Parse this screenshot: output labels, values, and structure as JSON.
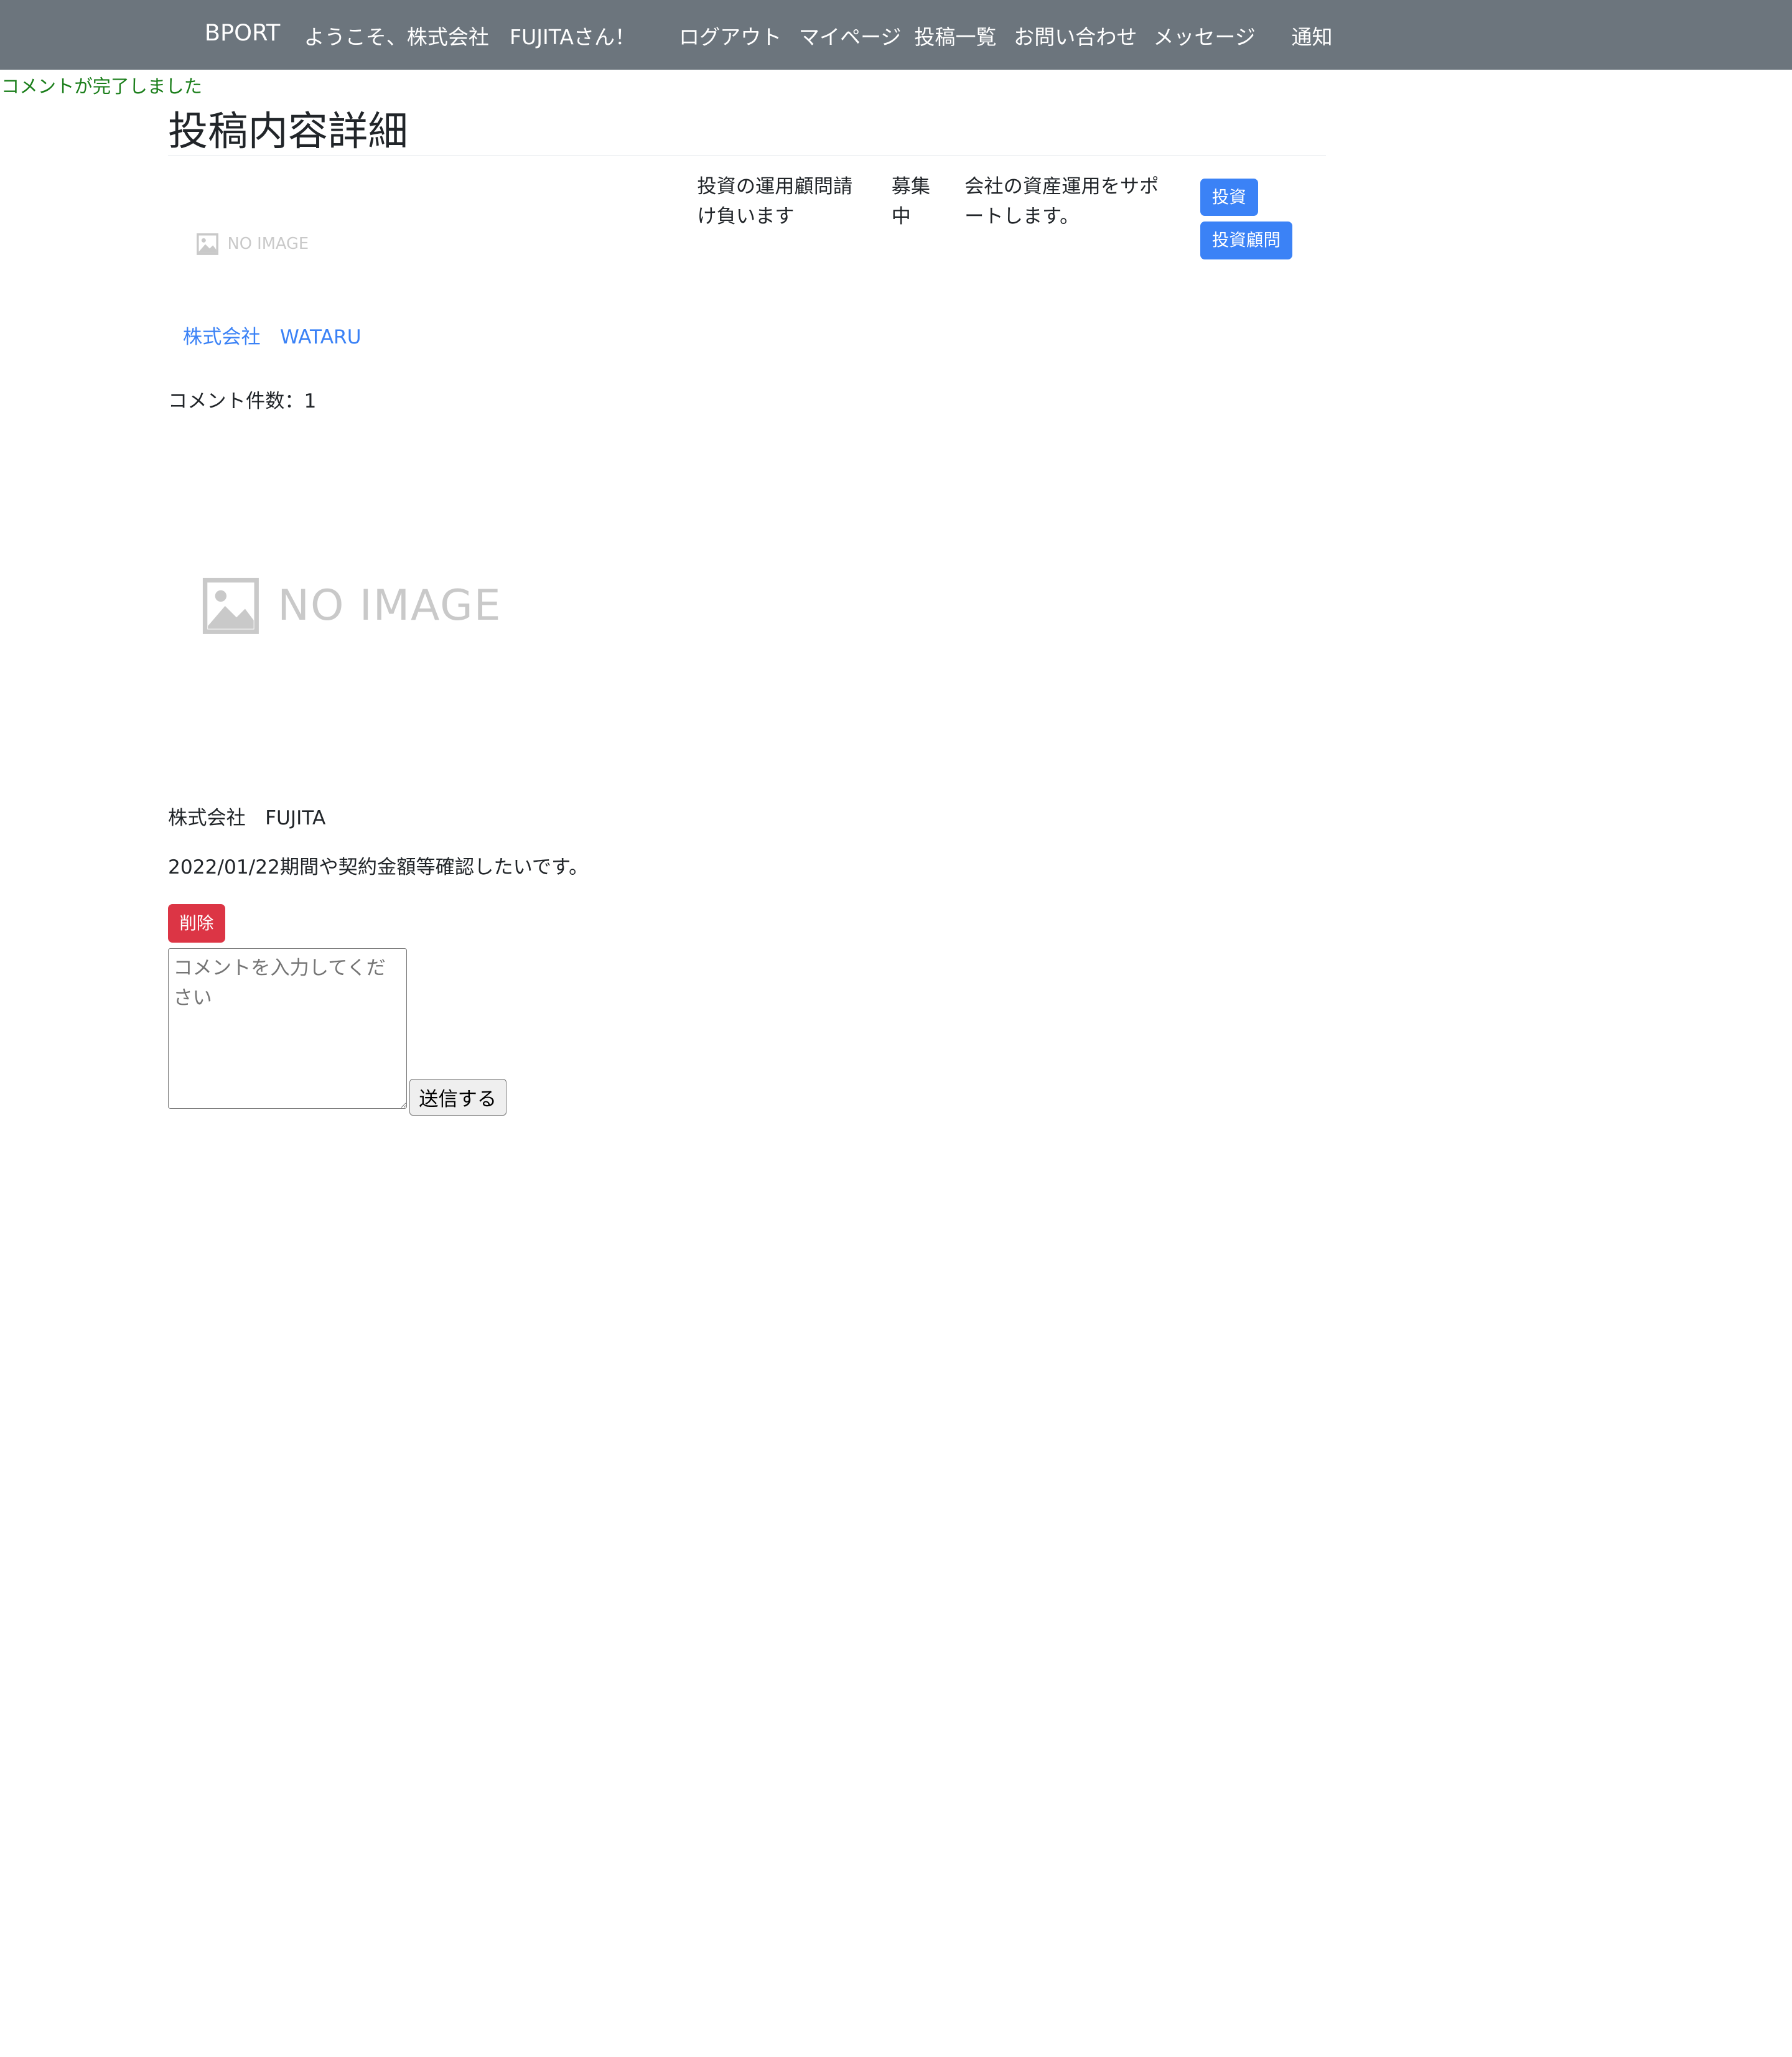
{
  "navbar": {
    "brand": "BPORT",
    "welcome": "ようこそ、株式会社　FUJITAさん！",
    "links": {
      "logout": "ログアウト",
      "mypage": "マイページ",
      "posts": "投稿一覧",
      "contact": "お問い合わせ",
      "messages": "メッセージ",
      "notifications": "通知"
    }
  },
  "flash": {
    "text": "コメントが完了しました",
    "color": "#1a7e1a"
  },
  "page": {
    "title": "投稿内容詳細"
  },
  "post": {
    "image_placeholder": "NO IMAGE",
    "title": "投資の運用顧問請け負います",
    "status": "募集中",
    "description": "会社の資産運用をサポートします。",
    "tags": [
      "投資",
      "投資顧問"
    ],
    "company": "株式会社　WATARU"
  },
  "comments": {
    "count_label": "コメント件数：1",
    "items": [
      {
        "image_placeholder": "NO IMAGE",
        "author": "株式会社　FUJITA",
        "body": "2022/01/22期間や契約金額等確認したいです。",
        "delete_label": "削除"
      }
    ]
  },
  "form": {
    "placeholder": "コメントを入力してください",
    "value": "",
    "submit_label": "送信する"
  },
  "colors": {
    "navbar_bg": "#6c757d",
    "tag_bg": "#3b82f6",
    "delete_bg": "#dc3545",
    "link": "#3b82f6"
  }
}
